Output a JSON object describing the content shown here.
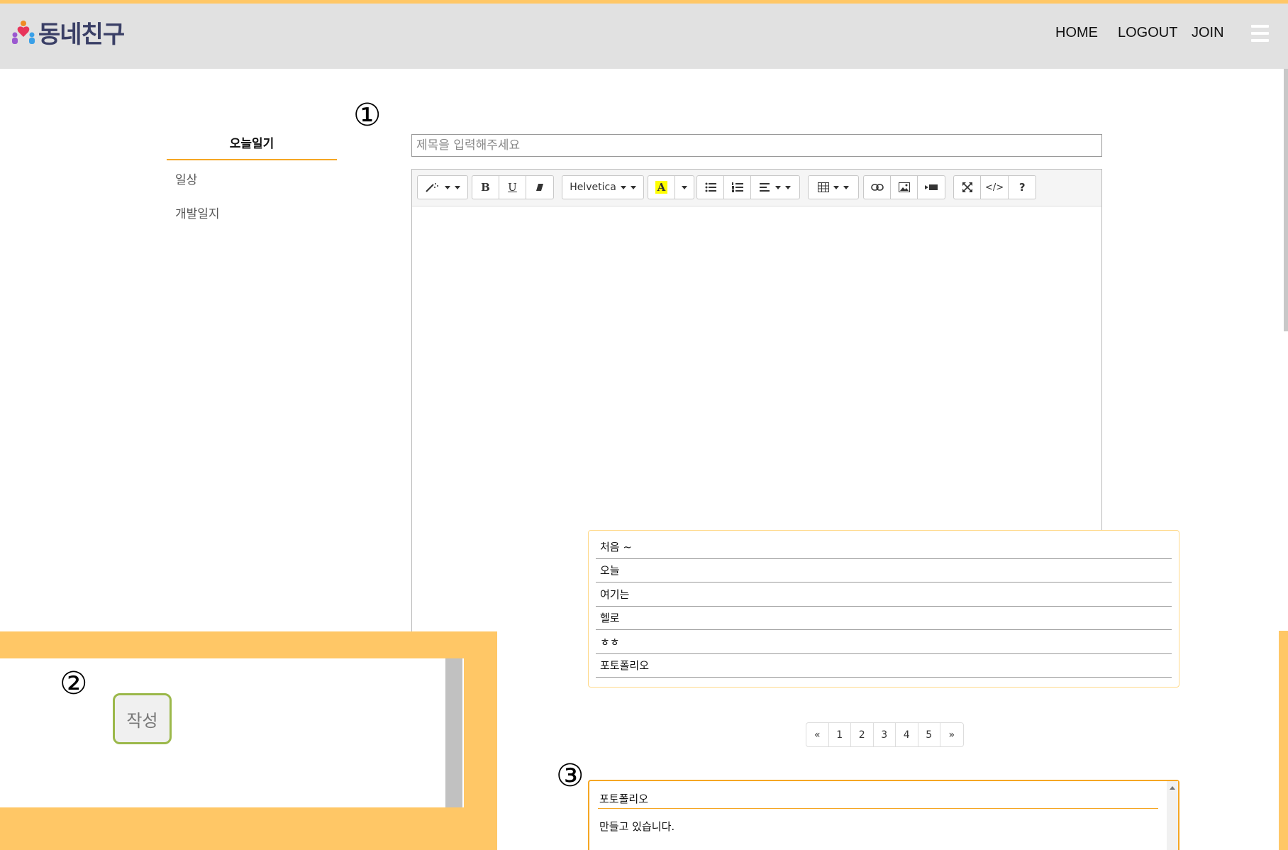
{
  "header": {
    "logo_text": "동네친구",
    "nav": {
      "home": "HOME",
      "logout": "LOGOUT",
      "join": "JOIN"
    }
  },
  "sidebar": {
    "title": "오늘일기",
    "items": [
      {
        "label": "일상"
      },
      {
        "label": "개발일지"
      }
    ]
  },
  "markers": {
    "one": "①",
    "two": "②",
    "three": "③"
  },
  "editor": {
    "title_placeholder": "제목을 입력해주세요",
    "font_name": "Helvetica",
    "bold": "B",
    "underline": "U",
    "highlight": "A",
    "code": "</>",
    "help": "?"
  },
  "list": {
    "items": [
      {
        "title": "처음 ~"
      },
      {
        "title": "오늘"
      },
      {
        "title": "여기는"
      },
      {
        "title": "헬로"
      },
      {
        "title": "ㅎㅎ"
      },
      {
        "title": "포토폴리오"
      }
    ]
  },
  "pagination": {
    "prev": "«",
    "pages": [
      "1",
      "2",
      "3",
      "4",
      "5"
    ],
    "next": "»"
  },
  "detail": {
    "title": "포토폴리오",
    "body": "만들고 있습니다."
  },
  "write_button": "작성",
  "colors": {
    "accent": "#ffc766",
    "orange": "#f5a623",
    "header_bg": "#e1e1e1",
    "button_border": "#9bb84a"
  }
}
